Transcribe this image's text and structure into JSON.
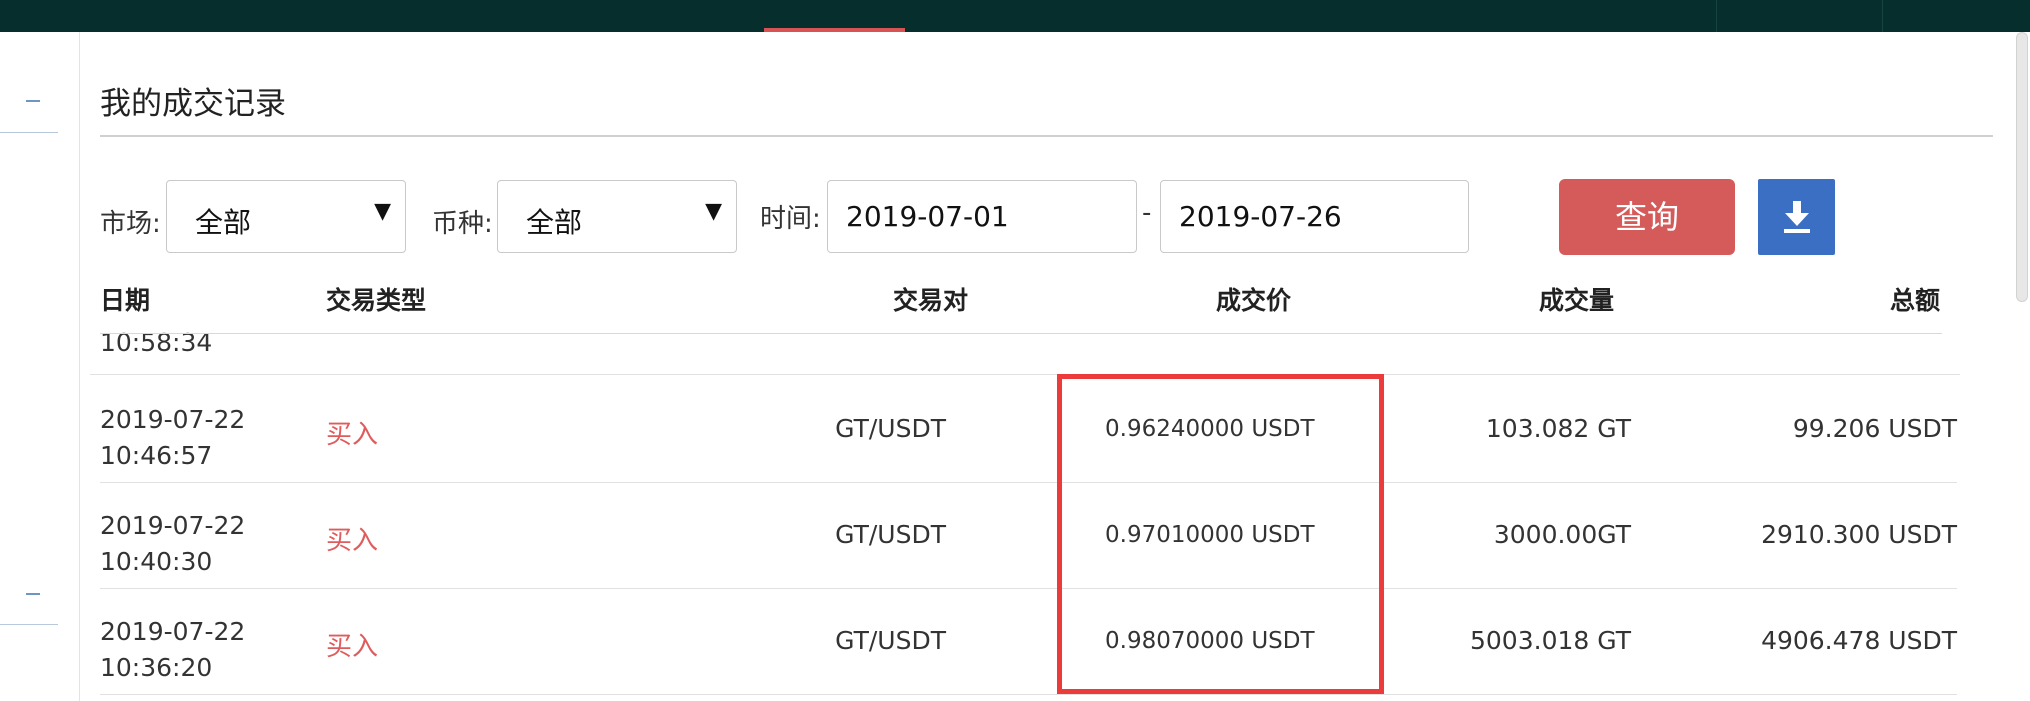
{
  "page": {
    "title": "我的成交记录"
  },
  "filters": {
    "market_label": "市场:",
    "market_value": "全部",
    "currency_label": "币种:",
    "currency_value": "全部",
    "time_label": "时间:",
    "date_from": "2019-07-01",
    "date_separator": "-",
    "date_to": "2019-07-26",
    "query_label": "查询"
  },
  "icons": {
    "download": "download-icon",
    "dropdown": "caret-down-icon"
  },
  "colors": {
    "header_bg": "#062e2c",
    "accent_red": "#d55b5b",
    "download_blue": "#3a6fc4",
    "buy_text": "#e05c5c",
    "highlight_border": "#ec3b3b"
  },
  "table": {
    "headers": {
      "date": "日期",
      "type": "交易类型",
      "pair": "交易对",
      "price": "成交价",
      "volume": "成交量",
      "total": "总额"
    },
    "partial_row_time": "10:58:34",
    "rows": [
      {
        "date": "2019-07-22",
        "time": "10:46:57",
        "type": "买入",
        "pair": "GT/USDT",
        "price": "0.96240000 USDT",
        "volume": "103.082 GT",
        "total": "99.206 USDT"
      },
      {
        "date": "2019-07-22",
        "time": "10:40:30",
        "type": "买入",
        "pair": "GT/USDT",
        "price": "0.97010000 USDT",
        "volume": "3000.00GT",
        "total": "2910.300 USDT"
      },
      {
        "date": "2019-07-22",
        "time": "10:36:20",
        "type": "买入",
        "pair": "GT/USDT",
        "price": "0.98070000 USDT",
        "volume": "5003.018 GT",
        "total": "4906.478 USDT"
      }
    ]
  }
}
